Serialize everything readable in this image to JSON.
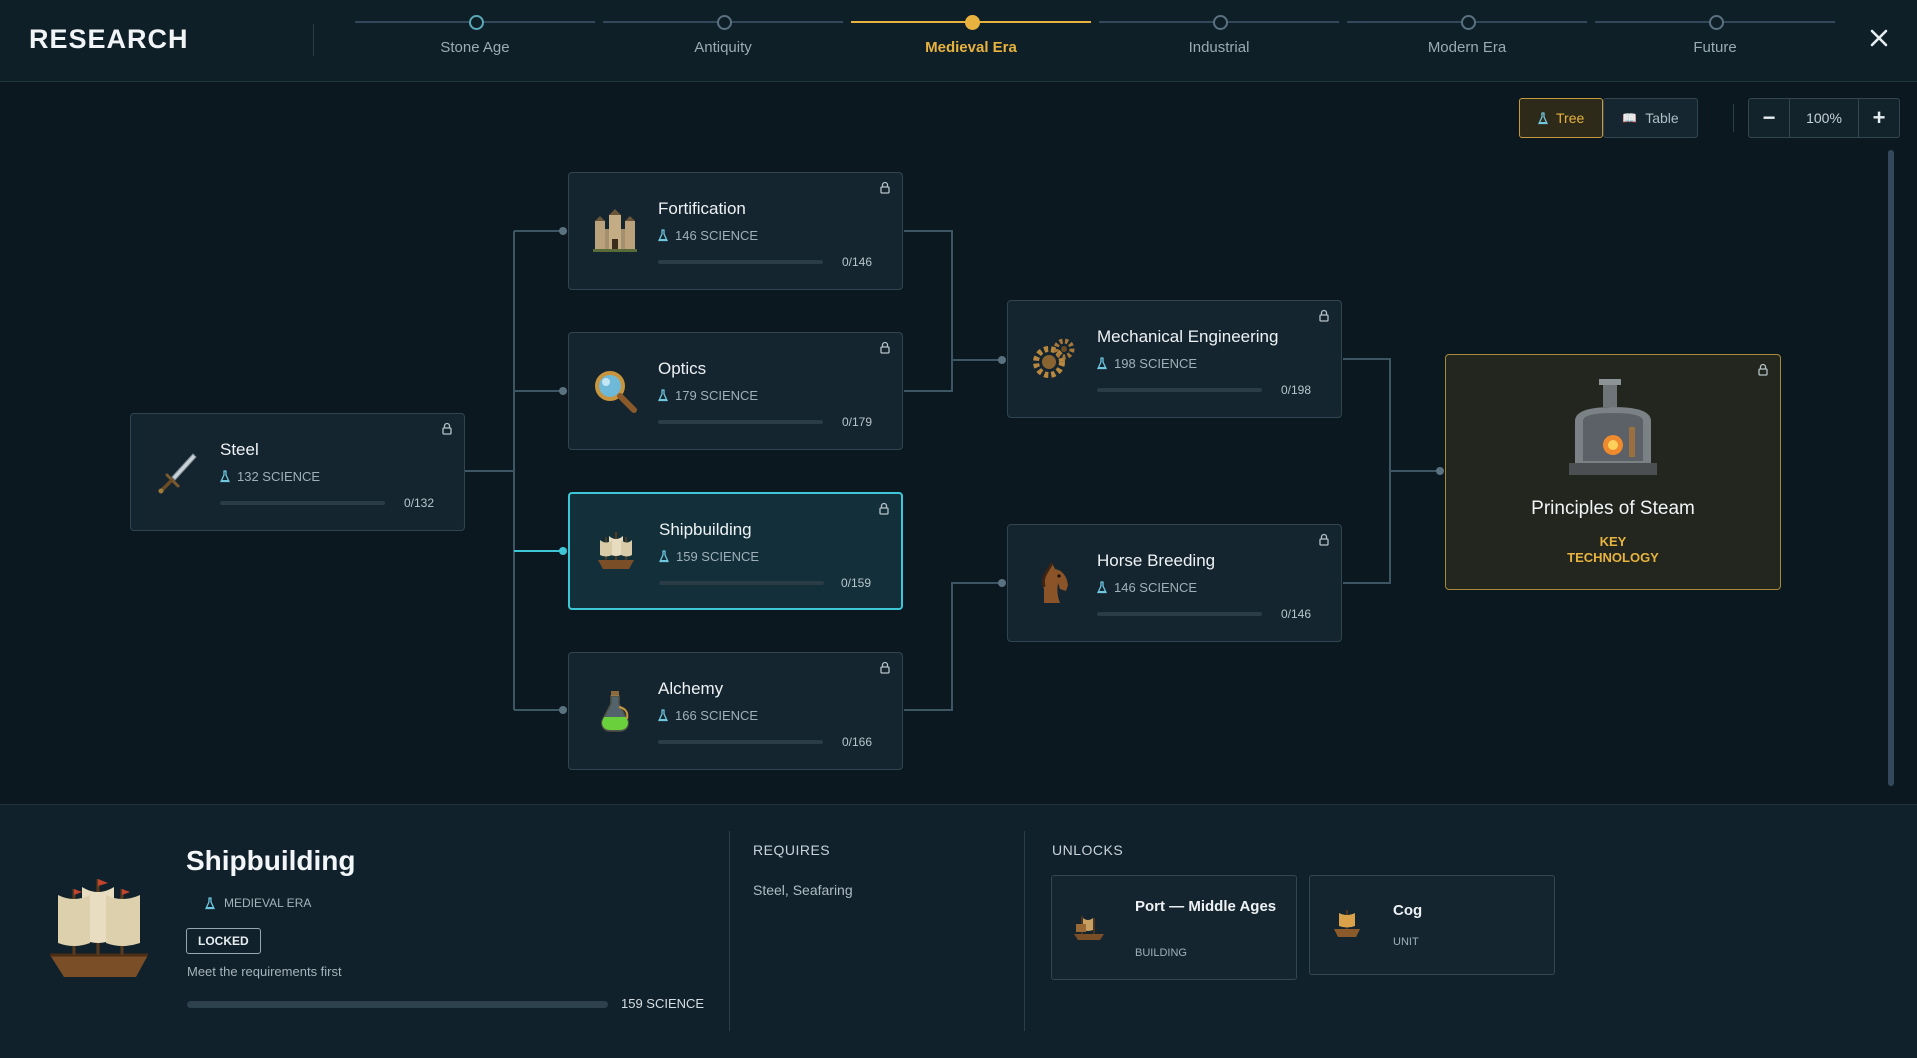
{
  "header": {
    "title": "RESEARCH",
    "eras": [
      {
        "label": "Stone Age",
        "state": "done"
      },
      {
        "label": "Antiquity",
        "state": "upcoming"
      },
      {
        "label": "Medieval Era",
        "state": "active"
      },
      {
        "label": "Industrial",
        "state": "upcoming"
      },
      {
        "label": "Modern Era",
        "state": "upcoming"
      },
      {
        "label": "Future",
        "state": "upcoming"
      }
    ],
    "close_icon": "close-icon"
  },
  "toolbar": {
    "tree_label": "Tree",
    "table_label": "Table",
    "active_view": "Tree",
    "zoom_out": "−",
    "zoom_value": "100%",
    "zoom_in": "+"
  },
  "techs": {
    "steel": {
      "name": "Steel",
      "cost": "132 SCIENCE",
      "progress": "0/132",
      "icon": "sword-icon"
    },
    "fortification": {
      "name": "Fortification",
      "cost": "146 SCIENCE",
      "progress": "0/146",
      "icon": "castle-icon"
    },
    "optics": {
      "name": "Optics",
      "cost": "179 SCIENCE",
      "progress": "0/179",
      "icon": "magnifier-icon"
    },
    "shipbuilding": {
      "name": "Shipbuilding",
      "cost": "159 SCIENCE",
      "progress": "0/159",
      "icon": "ship-icon"
    },
    "alchemy": {
      "name": "Alchemy",
      "cost": "166 SCIENCE",
      "progress": "0/166",
      "icon": "potion-icon"
    },
    "mech_eng": {
      "name": "Mechanical Engineering",
      "cost": "198 SCIENCE",
      "progress": "0/198",
      "icon": "gears-icon"
    },
    "horse": {
      "name": "Horse Breeding",
      "cost": "146 SCIENCE",
      "progress": "0/146",
      "icon": "horse-icon"
    },
    "steam": {
      "name": "Principles of Steam",
      "tag_line1": "KEY",
      "tag_line2": "TECHNOLOGY",
      "icon": "steam-engine-icon"
    }
  },
  "detail": {
    "name": "Shipbuilding",
    "era": "MEDIEVAL ERA",
    "status": "LOCKED",
    "note": "Meet the requirements first",
    "cost": "159 SCIENCE",
    "progress_fraction": 0,
    "requires_heading": "REQUIRES",
    "requires": "Steel, Seafaring",
    "unlocks_heading": "UNLOCKS",
    "unlocks": [
      {
        "name": "Port — Middle Ages",
        "type": "BUILDING",
        "icon": "port-icon"
      },
      {
        "name": "Cog",
        "type": "UNIT",
        "icon": "cog-ship-icon"
      }
    ]
  },
  "colors": {
    "accent_gold": "#e7b33e",
    "selected_cyan": "#3fc6d6",
    "background": "#0b1820"
  }
}
